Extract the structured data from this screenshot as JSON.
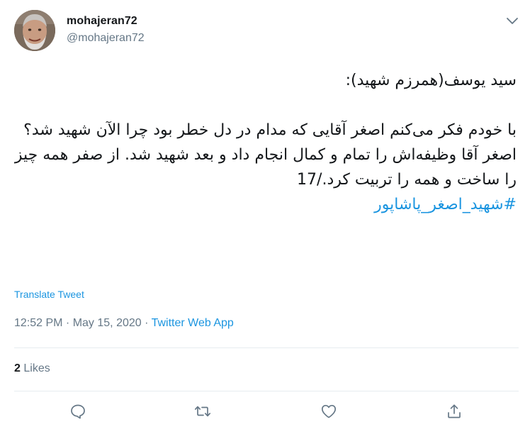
{
  "user": {
    "display_name": "mohajeran72",
    "handle": "@mohajeran72"
  },
  "tweet": {
    "line1": "سید یوسف(همرزم شهید):",
    "paragraph": "با خودم فکر می‌کنم اصغر آقایی که مدام در دل خطر بود چرا الآن شهید شد؟ اصغر آقا وظیفه‌اش را تمام و کمال انجام داد و بعد شهید شد. از صفر همه چیز را ساخت و همه را تربیت کرد./17",
    "hashtag": "#شهید_اصغر_پاشاپور"
  },
  "translate_label": "Translate Tweet",
  "meta": {
    "time": "12:52 PM",
    "separator1": " · ",
    "date": "May 15, 2020",
    "separator2": " · ",
    "source": "Twitter Web App"
  },
  "likes": {
    "count": "2",
    "label": "Likes"
  },
  "icons": {
    "caret": "chevron-down-icon",
    "reply": "reply-icon",
    "retweet": "retweet-icon",
    "like": "heart-icon",
    "share": "share-icon"
  },
  "colors": {
    "accent": "#1b95e0",
    "text": "#14171a",
    "secondary": "#657786",
    "divider": "#e6ecf0"
  }
}
